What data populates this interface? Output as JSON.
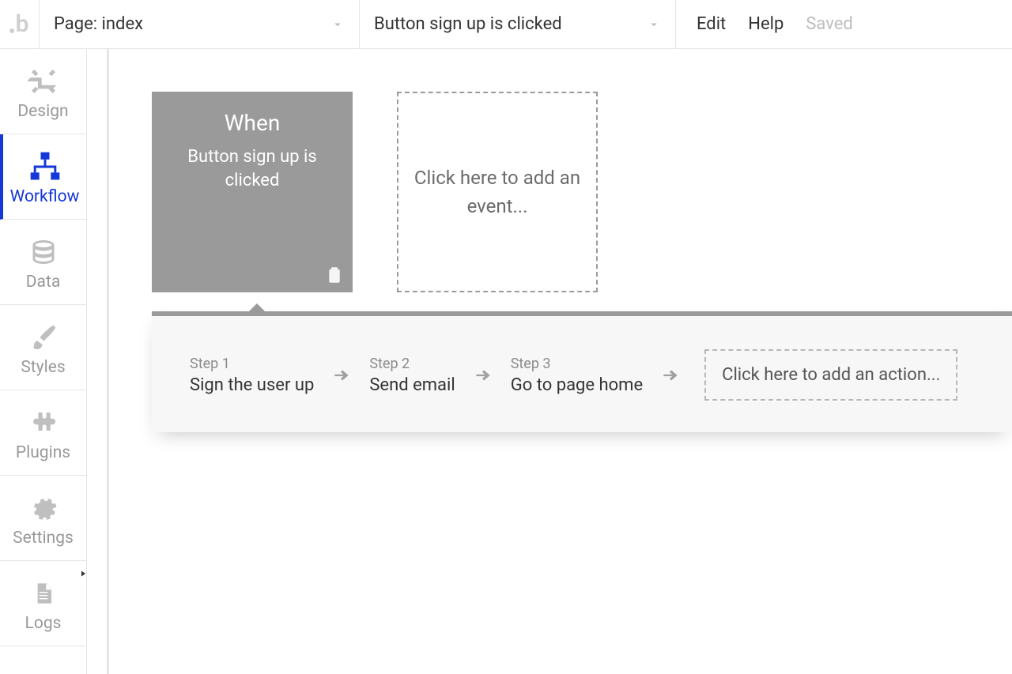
{
  "topbar": {
    "page_dropdown": "Page: index",
    "event_dropdown": "Button sign up is clicked",
    "edit": "Edit",
    "help": "Help",
    "saved": "Saved"
  },
  "sidebar": {
    "items": [
      {
        "label": "Design"
      },
      {
        "label": "Workflow"
      },
      {
        "label": "Data"
      },
      {
        "label": "Styles"
      },
      {
        "label": "Plugins"
      },
      {
        "label": "Settings"
      },
      {
        "label": "Logs"
      }
    ]
  },
  "events": {
    "selected": {
      "heading": "When",
      "description": "Button sign up is clicked"
    },
    "add_placeholder": "Click here to add an event..."
  },
  "steps": {
    "items": [
      {
        "label": "Step 1",
        "action": "Sign the user up"
      },
      {
        "label": "Step 2",
        "action": "Send email"
      },
      {
        "label": "Step 3",
        "action": "Go to page home"
      }
    ],
    "add_placeholder": "Click here to add an action..."
  }
}
